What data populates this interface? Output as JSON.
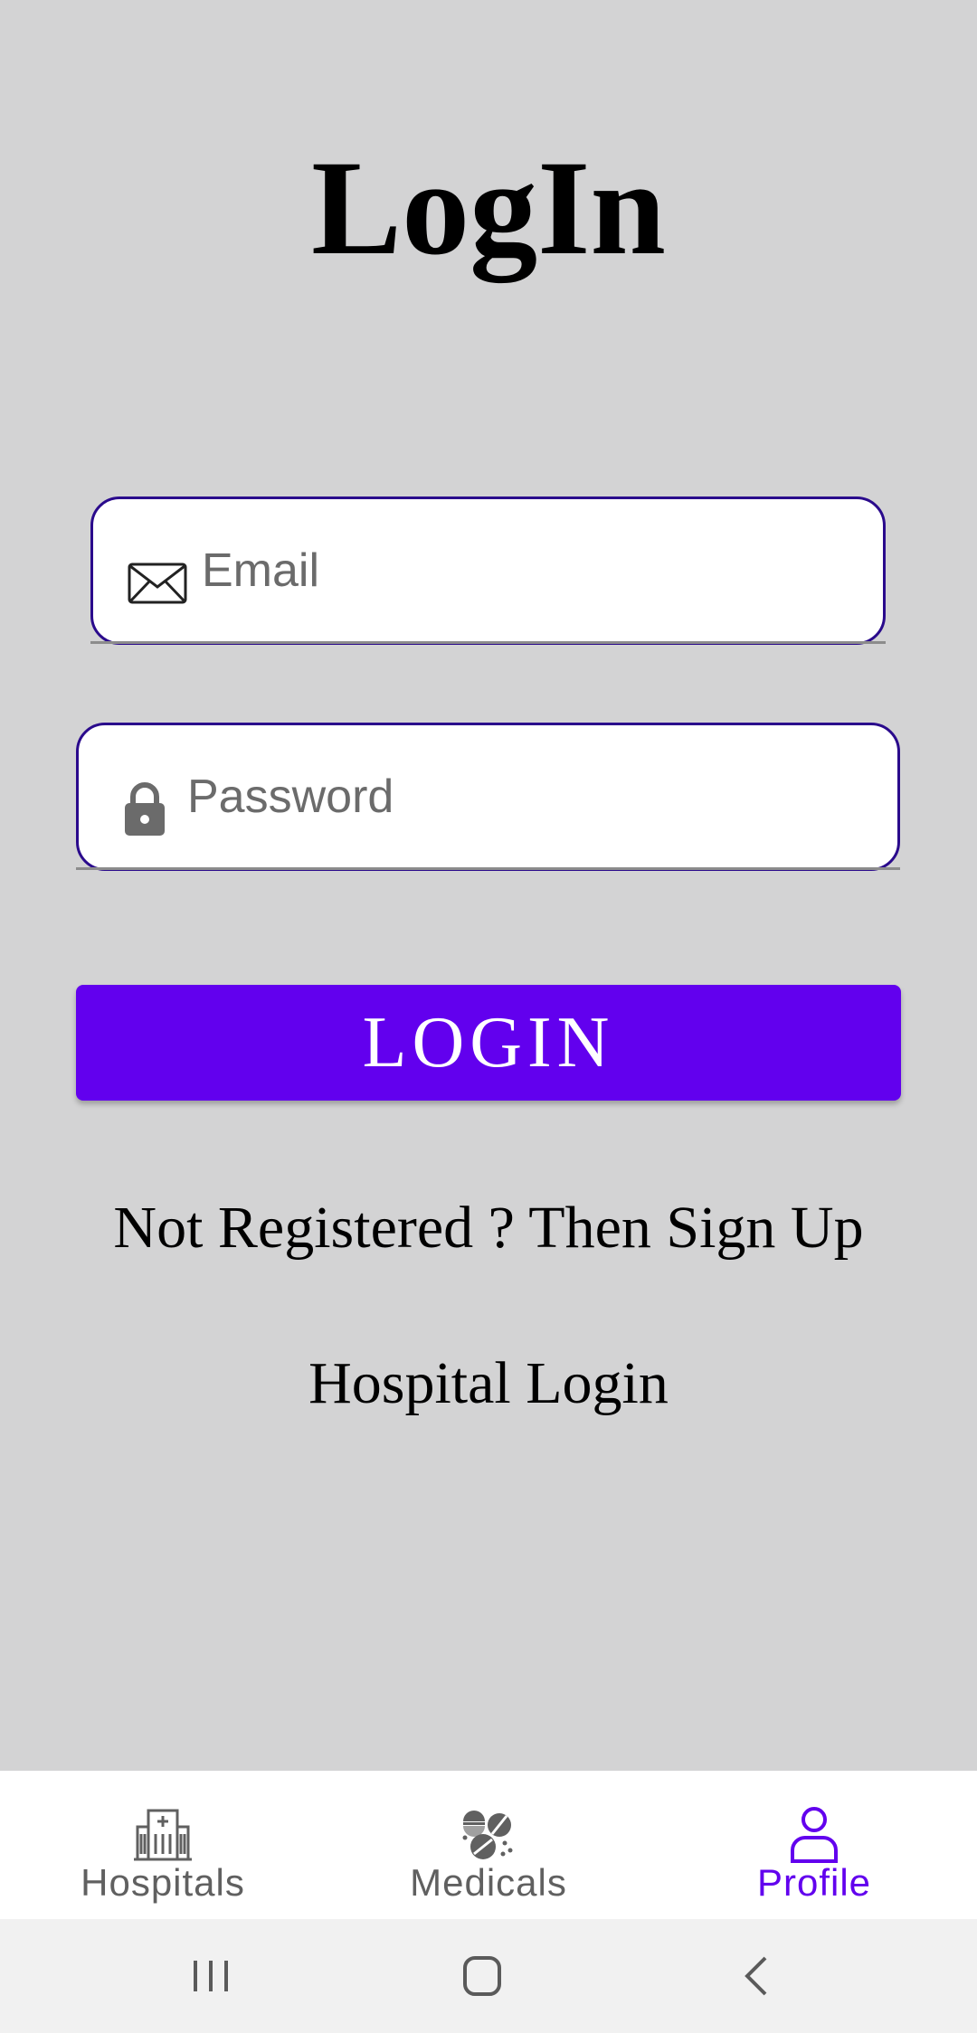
{
  "page": {
    "title": "LogIn"
  },
  "form": {
    "email_placeholder": "Email",
    "email_value": "",
    "password_placeholder": "Password",
    "password_value": "",
    "login_label": "LOGIN",
    "signup_link": "Not Registered ? Then Sign Up",
    "hospital_login_link": "Hospital Login"
  },
  "bottom_nav": {
    "items": [
      {
        "label": "Hospitals",
        "icon": "hospital-icon",
        "active": false
      },
      {
        "label": "Medicals",
        "icon": "pills-icon",
        "active": false
      },
      {
        "label": "Profile",
        "icon": "person-icon",
        "active": true
      }
    ]
  },
  "colors": {
    "background": "#d3d3d4",
    "accent": "#6200ee",
    "field_border": "#2a0a8c",
    "nav_inactive": "#606060"
  }
}
